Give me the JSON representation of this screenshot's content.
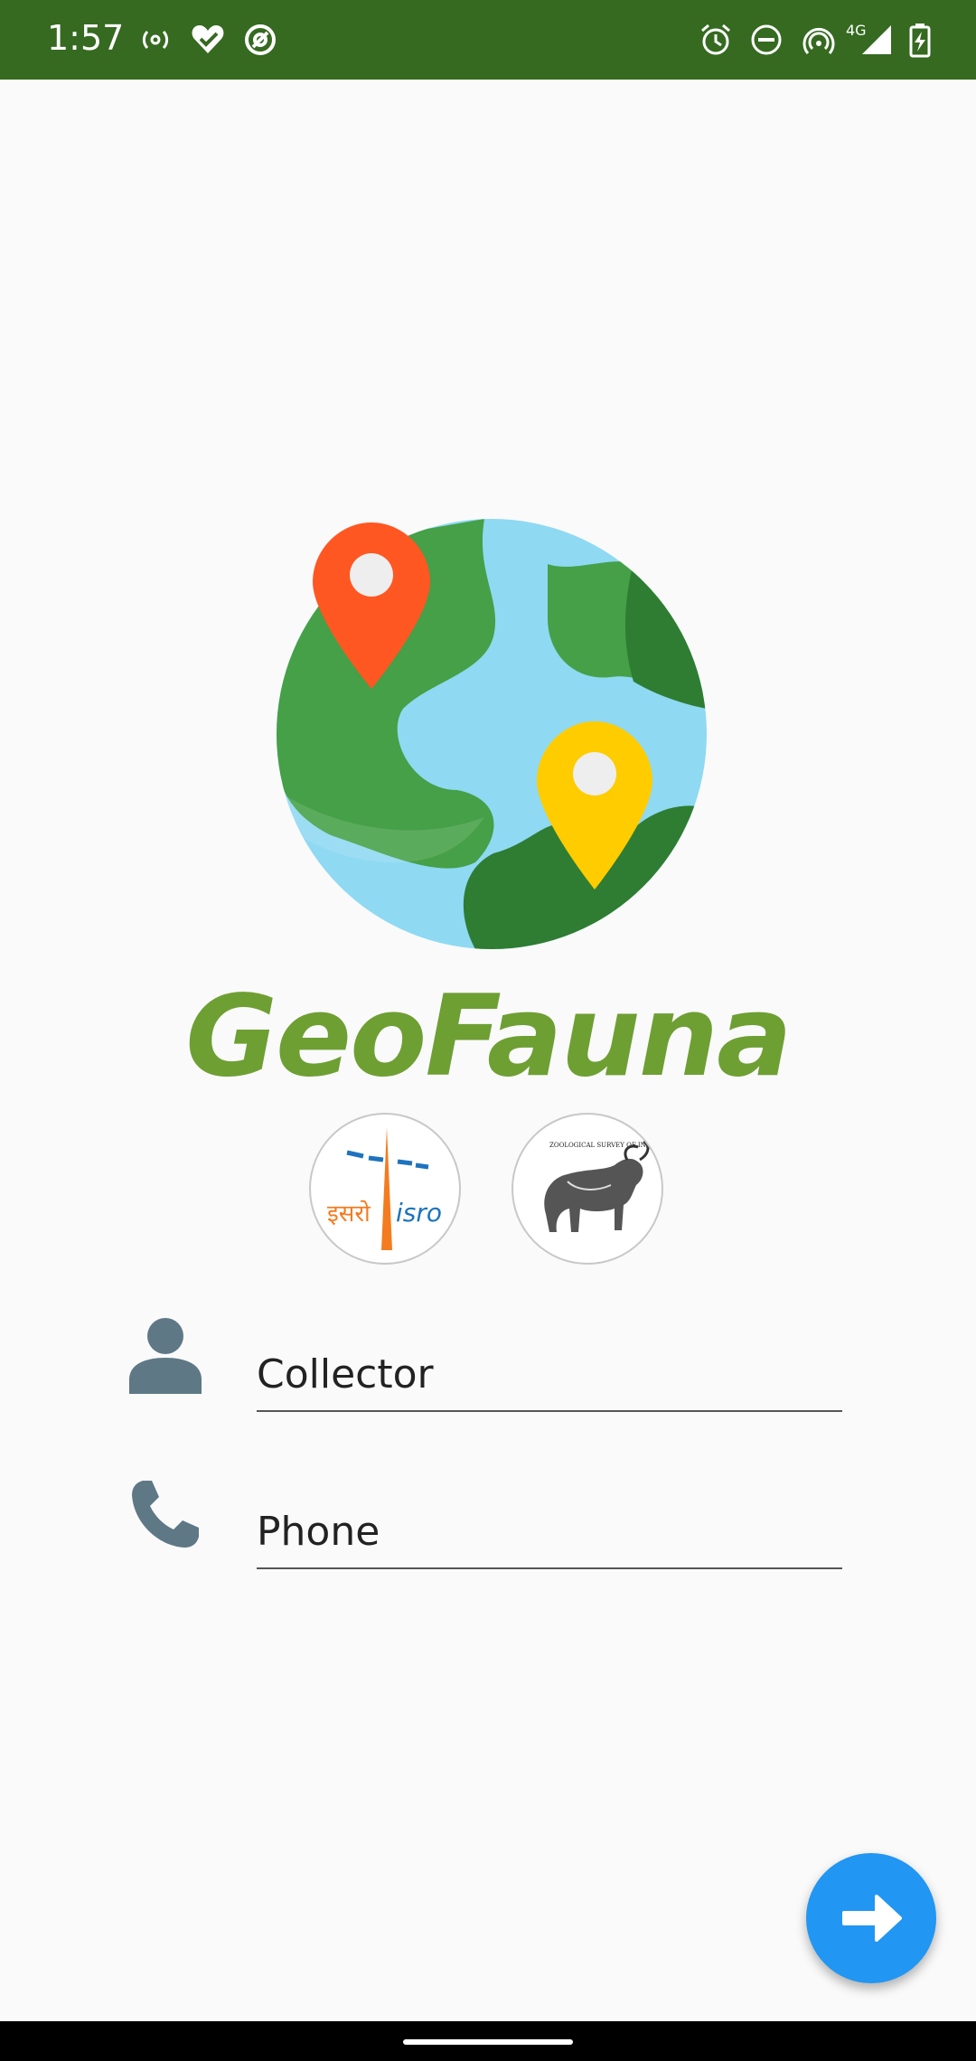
{
  "status_bar": {
    "time": "1:57",
    "network_label": "4G",
    "left_icons": [
      "hotspot-icon",
      "heart-check-icon",
      "at-sign-icon"
    ],
    "right_icons": [
      "alarm-icon",
      "dnd-icon",
      "cast-icon",
      "signal-icon",
      "battery-charging-icon"
    ]
  },
  "app": {
    "title": "GeoFauna",
    "logo_icon": "globe-with-pins-icon",
    "partner_logos": [
      {
        "name": "isro-logo",
        "text_hindi": "इसरो",
        "text_latin": "isro"
      },
      {
        "name": "zoological-survey-logo",
        "caption": "ZOOLOGICAL SURVEY OF INDIA 1916"
      }
    ]
  },
  "form": {
    "collector": {
      "placeholder": "Collector",
      "value": "",
      "icon": "person-icon"
    },
    "phone": {
      "placeholder": "Phone",
      "value": "",
      "icon": "phone-icon"
    }
  },
  "fab": {
    "icon": "arrow-right-icon",
    "color": "#2196f3"
  },
  "colors": {
    "status_bar": "#356a20",
    "title": "#6e9f33",
    "icon_gray": "#5f7886",
    "background": "#fafafa"
  }
}
